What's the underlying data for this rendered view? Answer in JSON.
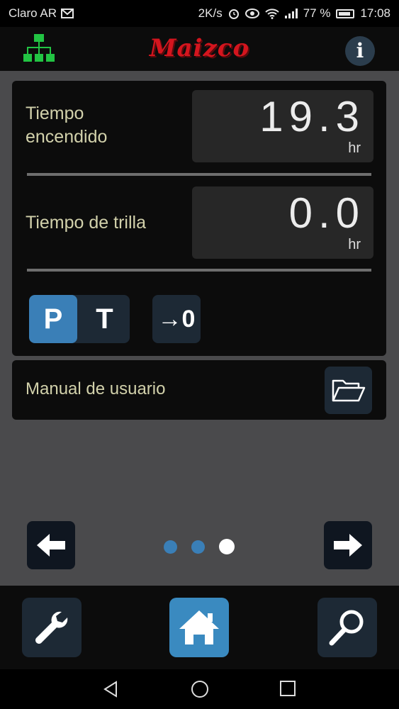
{
  "status_bar": {
    "carrier": "Claro AR",
    "speed": "2K/s",
    "battery": "77 %",
    "time": "17:08"
  },
  "app_bar": {
    "logo_text": "Maizco",
    "info_label": "i"
  },
  "counters": [
    {
      "label_line1": "Tiempo",
      "label_line2": "encendido",
      "value": "19.3",
      "unit": "hr"
    },
    {
      "label": "Tiempo de trilla",
      "value": "0.0",
      "unit": "hr"
    }
  ],
  "toggle": {
    "p_label": "P",
    "t_label": "T",
    "selected": "P"
  },
  "reset_label": "→0",
  "manual": {
    "label": "Manual de usuario"
  },
  "pager": {
    "count": 3,
    "active_index": 2
  },
  "colors": {
    "accent": "#3a7fb7",
    "label_text": "#d2d1ab",
    "brand_red": "#d4151e",
    "tree_green": "#22c443"
  },
  "icons": {
    "network": "network-tree-icon",
    "info": "info-icon",
    "folder": "folder-open-icon",
    "prev": "arrow-left-icon",
    "next": "arrow-right-icon",
    "settings": "wrench-icon",
    "home": "home-icon",
    "search": "search-icon"
  }
}
